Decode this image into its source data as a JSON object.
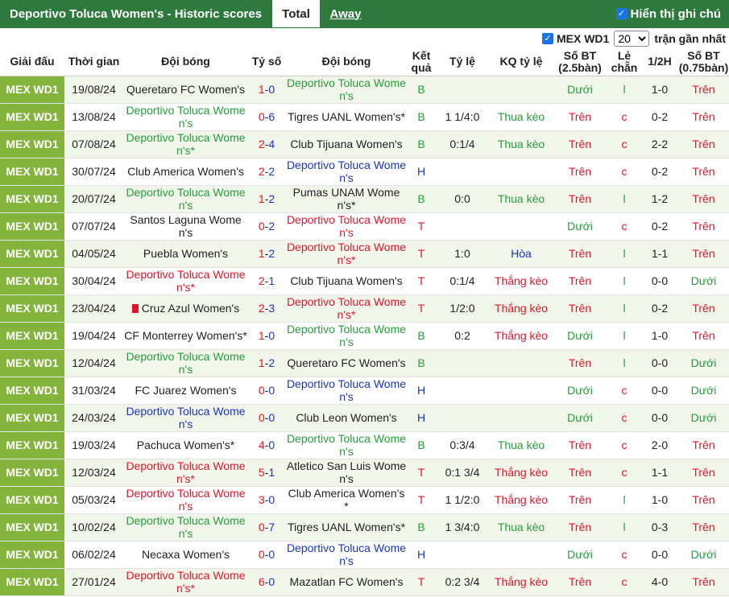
{
  "header": {
    "title": "Deportivo Toluca Women's - Historic scores",
    "tab_total": "Total",
    "tab_away": "Away",
    "show_hint_label": "Hiển thị ghi chú"
  },
  "filter": {
    "league_label": "MEX WD1",
    "count_value": "20",
    "recent_label": "trận gần nhất"
  },
  "columns": {
    "league": "Giải đấu",
    "time": "Thời gian",
    "home": "Đội bóng",
    "score": "Tỷ số",
    "away": "Đội bóng",
    "result": "Kết quả",
    "odds": "Tỷ lệ",
    "odds_result": "KQ tỷ lệ",
    "ou25": "Số BT (2.5bàn)",
    "oddeven": "Lẻ chẵn",
    "half": "1/2H",
    "ou075": "Số BT (0.75bàn)"
  },
  "colors": {
    "header_green": "#2d7a3c",
    "league_cell": "#84b43c",
    "team_green": "#249e3a",
    "red": "#e3152a",
    "blue": "#1a33c4"
  },
  "rows": [
    {
      "league": "MEX WD1",
      "date": "19/08/24",
      "home": "Queretaro FC Women's",
      "home_c": "dark",
      "sh": "1",
      "sep": "-",
      "sa": "0",
      "away": "Deportivo Toluca Women's",
      "away_c": "green",
      "res": "B",
      "res_c": "green",
      "odds": "",
      "oddres": "",
      "oddres_c": "dark",
      "ou": "Dưới",
      "ou_c": "green",
      "oe": "l",
      "oe_c": "green",
      "half": "1-0",
      "ou2": "Trên",
      "ou2_c": "red"
    },
    {
      "league": "MEX WD1",
      "date": "13/08/24",
      "home": "Deportivo Toluca Women's",
      "home_c": "green",
      "sh": "0",
      "sep": "-",
      "sa": "6",
      "away": "Tigres UANL Women's*",
      "away_c": "dark",
      "res": "B",
      "res_c": "green",
      "odds": "1 1/4:0",
      "oddres": "Thua kèo",
      "oddres_c": "green",
      "ou": "Trên",
      "ou_c": "red",
      "oe": "c",
      "oe_c": "red",
      "half": "0-2",
      "ou2": "Trên",
      "ou2_c": "red"
    },
    {
      "league": "MEX WD1",
      "date": "07/08/24",
      "home": "Deportivo Toluca Women's*",
      "home_c": "green",
      "sh": "2",
      "sep": "-",
      "sa": "4",
      "away": "Club Tijuana Women's",
      "away_c": "dark",
      "res": "B",
      "res_c": "green",
      "odds": "0:1/4",
      "oddres": "Thua kèo",
      "oddres_c": "green",
      "ou": "Trên",
      "ou_c": "red",
      "oe": "c",
      "oe_c": "red",
      "half": "2-2",
      "ou2": "Trên",
      "ou2_c": "red"
    },
    {
      "league": "MEX WD1",
      "date": "30/07/24",
      "home": "Club America Women's",
      "home_c": "dark",
      "sh": "2",
      "sep": "-",
      "sa": "2",
      "away": "Deportivo Toluca Women's",
      "away_c": "blue",
      "res": "H",
      "res_c": "blue",
      "odds": "",
      "oddres": "",
      "oddres_c": "dark",
      "ou": "Trên",
      "ou_c": "red",
      "oe": "c",
      "oe_c": "red",
      "half": "0-2",
      "ou2": "Trên",
      "ou2_c": "red"
    },
    {
      "league": "MEX WD1",
      "date": "20/07/24",
      "home": "Deportivo Toluca Women's",
      "home_c": "green",
      "sh": "1",
      "sep": "-",
      "sa": "2",
      "away": "Pumas UNAM Women's*",
      "away_c": "dark",
      "res": "B",
      "res_c": "green",
      "odds": "0:0",
      "oddres": "Thua kèo",
      "oddres_c": "green",
      "ou": "Trên",
      "ou_c": "red",
      "oe": "l",
      "oe_c": "green",
      "half": "1-2",
      "ou2": "Trên",
      "ou2_c": "red"
    },
    {
      "league": "MEX WD1",
      "date": "07/07/24",
      "home": "Santos Laguna Women's",
      "home_c": "dark",
      "sh": "0",
      "sep": "-",
      "sa": "2",
      "away": "Deportivo Toluca Women's",
      "away_c": "red",
      "res": "T",
      "res_c": "red",
      "odds": "",
      "oddres": "",
      "oddres_c": "dark",
      "ou": "Dưới",
      "ou_c": "green",
      "oe": "c",
      "oe_c": "red",
      "half": "0-2",
      "ou2": "Trên",
      "ou2_c": "red"
    },
    {
      "league": "MEX WD1",
      "date": "04/05/24",
      "home": "Puebla Women's",
      "home_c": "dark",
      "sh": "1",
      "sep": "-",
      "sa": "2",
      "away": "Deportivo Toluca Women's*",
      "away_c": "red",
      "res": "T",
      "res_c": "red",
      "odds": "1:0",
      "oddres": "Hòa",
      "oddres_c": "blue",
      "ou": "Trên",
      "ou_c": "red",
      "oe": "l",
      "oe_c": "green",
      "half": "1-1",
      "ou2": "Trên",
      "ou2_c": "red"
    },
    {
      "league": "MEX WD1",
      "date": "30/04/24",
      "home": "Deportivo Toluca Women's*",
      "home_c": "red",
      "sh": "2",
      "sep": "-",
      "sa": "1",
      "away": "Club Tijuana Women's",
      "away_c": "dark",
      "res": "T",
      "res_c": "red",
      "odds": "0:1/4",
      "oddres": "Thắng kèo",
      "oddres_c": "red",
      "ou": "Trên",
      "ou_c": "red",
      "oe": "l",
      "oe_c": "green",
      "half": "0-0",
      "ou2": "Dưới",
      "ou2_c": "green"
    },
    {
      "league": "MEX WD1",
      "date": "23/04/24",
      "home": "Cruz Azul Women's",
      "home_c": "dark",
      "home_card": true,
      "sh": "2",
      "sep": "-",
      "sa": "3",
      "away": "Deportivo Toluca Women's*",
      "away_c": "red",
      "res": "T",
      "res_c": "red",
      "odds": "1/2:0",
      "oddres": "Thắng kèo",
      "oddres_c": "red",
      "ou": "Trên",
      "ou_c": "red",
      "oe": "l",
      "oe_c": "green",
      "half": "0-2",
      "ou2": "Trên",
      "ou2_c": "red"
    },
    {
      "league": "MEX WD1",
      "date": "19/04/24",
      "home": "CF Monterrey Women's*",
      "home_c": "dark",
      "sh": "1",
      "sep": "-",
      "sa": "0",
      "away": "Deportivo Toluca Women's",
      "away_c": "green",
      "res": "B",
      "res_c": "green",
      "odds": "0:2",
      "oddres": "Thắng kèo",
      "oddres_c": "red",
      "ou": "Dưới",
      "ou_c": "green",
      "oe": "l",
      "oe_c": "green",
      "half": "1-0",
      "ou2": "Trên",
      "ou2_c": "red"
    },
    {
      "league": "MEX WD1",
      "date": "12/04/24",
      "home": "Deportivo Toluca Women's",
      "home_c": "green",
      "sh": "1",
      "sep": "-",
      "sa": "2",
      "away": "Queretaro FC Women's",
      "away_c": "dark",
      "res": "B",
      "res_c": "green",
      "odds": "",
      "oddres": "",
      "oddres_c": "dark",
      "ou": "Trên",
      "ou_c": "red",
      "oe": "l",
      "oe_c": "green",
      "half": "0-0",
      "ou2": "Dưới",
      "ou2_c": "green"
    },
    {
      "league": "MEX WD1",
      "date": "31/03/24",
      "home": "FC Juarez Women's",
      "home_c": "dark",
      "sh": "0",
      "sep": "-",
      "sa": "0",
      "away": "Deportivo Toluca Women's",
      "away_c": "blue",
      "res": "H",
      "res_c": "blue",
      "odds": "",
      "oddres": "",
      "oddres_c": "dark",
      "ou": "Dưới",
      "ou_c": "green",
      "oe": "c",
      "oe_c": "red",
      "half": "0-0",
      "ou2": "Dưới",
      "ou2_c": "green"
    },
    {
      "league": "MEX WD1",
      "date": "24/03/24",
      "home": "Deportivo Toluca Women's",
      "home_c": "blue",
      "sh": "0",
      "sep": "-",
      "sa": "0",
      "away": "Club Leon Women's",
      "away_c": "dark",
      "res": "H",
      "res_c": "blue",
      "odds": "",
      "oddres": "",
      "oddres_c": "dark",
      "ou": "Dưới",
      "ou_c": "green",
      "oe": "c",
      "oe_c": "red",
      "half": "0-0",
      "ou2": "Dưới",
      "ou2_c": "green"
    },
    {
      "league": "MEX WD1",
      "date": "19/03/24",
      "home": "Pachuca Women's*",
      "home_c": "dark",
      "sh": "4",
      "sep": "-",
      "sa": "0",
      "away": "Deportivo Toluca Women's",
      "away_c": "green",
      "res": "B",
      "res_c": "green",
      "odds": "0:3/4",
      "oddres": "Thua kèo",
      "oddres_c": "green",
      "ou": "Trên",
      "ou_c": "red",
      "oe": "c",
      "oe_c": "red",
      "half": "2-0",
      "ou2": "Trên",
      "ou2_c": "red"
    },
    {
      "league": "MEX WD1",
      "date": "12/03/24",
      "home": "Deportivo Toluca Women's*",
      "home_c": "red",
      "sh": "5",
      "sep": "-",
      "sa": "1",
      "away": "Atletico San Luis Women's",
      "away_c": "dark",
      "res": "T",
      "res_c": "red",
      "odds": "0:1 3/4",
      "oddres": "Thắng kèo",
      "oddres_c": "red",
      "ou": "Trên",
      "ou_c": "red",
      "oe": "c",
      "oe_c": "red",
      "half": "1-1",
      "ou2": "Trên",
      "ou2_c": "red"
    },
    {
      "league": "MEX WD1",
      "date": "05/03/24",
      "home": "Deportivo Toluca Women's",
      "home_c": "red",
      "sh": "3",
      "sep": "-",
      "sa": "0",
      "away": "Club America Women's*",
      "away_c": "dark",
      "res": "T",
      "res_c": "red",
      "odds": "1 1/2:0",
      "oddres": "Thắng kèo",
      "oddres_c": "red",
      "ou": "Trên",
      "ou_c": "red",
      "oe": "l",
      "oe_c": "green",
      "half": "1-0",
      "ou2": "Trên",
      "ou2_c": "red"
    },
    {
      "league": "MEX WD1",
      "date": "10/02/24",
      "home": "Deportivo Toluca Women's",
      "home_c": "green",
      "sh": "0",
      "sep": "-",
      "sa": "7",
      "away": "Tigres UANL Women's*",
      "away_c": "dark",
      "res": "B",
      "res_c": "green",
      "odds": "1 3/4:0",
      "oddres": "Thua kèo",
      "oddres_c": "green",
      "ou": "Trên",
      "ou_c": "red",
      "oe": "l",
      "oe_c": "green",
      "half": "0-3",
      "ou2": "Trên",
      "ou2_c": "red"
    },
    {
      "league": "MEX WD1",
      "date": "06/02/24",
      "home": "Necaxa Women's",
      "home_c": "dark",
      "sh": "0",
      "sep": "-",
      "sa": "0",
      "away": "Deportivo Toluca Women's",
      "away_c": "blue",
      "res": "H",
      "res_c": "blue",
      "odds": "",
      "oddres": "",
      "oddres_c": "dark",
      "ou": "Dưới",
      "ou_c": "green",
      "oe": "c",
      "oe_c": "red",
      "half": "0-0",
      "ou2": "Dưới",
      "ou2_c": "green"
    },
    {
      "league": "MEX WD1",
      "date": "27/01/24",
      "home": "Deportivo Toluca Women's*",
      "home_c": "red",
      "sh": "6",
      "sep": "-",
      "sa": "0",
      "away": "Mazatlan FC Women's",
      "away_c": "dark",
      "res": "T",
      "res_c": "red",
      "odds": "0:2 3/4",
      "oddres": "Thắng kèo",
      "oddres_c": "red",
      "ou": "Trên",
      "ou_c": "red",
      "oe": "c",
      "oe_c": "red",
      "half": "4-0",
      "ou2": "Trên",
      "ou2_c": "red"
    }
  ]
}
